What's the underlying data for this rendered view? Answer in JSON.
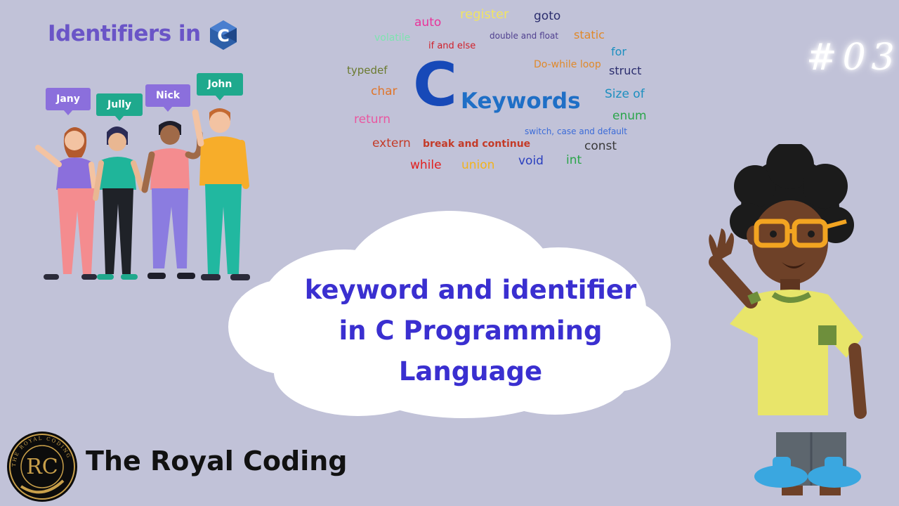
{
  "identifiers_heading": "Identifiers in",
  "c_logo_letter": "C",
  "people": [
    {
      "name": "Jany",
      "color": "#8b6fdc"
    },
    {
      "name": "Jully",
      "color": "#1fa98d"
    },
    {
      "name": "Nick",
      "color": "#8b6fdc"
    },
    {
      "name": "John",
      "color": "#1fa98d"
    }
  ],
  "keyword_cloud": {
    "big_letter": "C",
    "title": "Keywords",
    "words": {
      "register": "register",
      "goto": "goto",
      "auto": "auto",
      "volatile": "volatile",
      "double_float": "double and float",
      "static": "static",
      "if_else": "if and else",
      "for": "for",
      "typedef": "typedef",
      "do_while": "Do-while loop",
      "struct": "struct",
      "char": "char",
      "size_of": "Size of",
      "return": "return",
      "enum": "enum",
      "switch": "switch, case and default",
      "extern": "extern",
      "break_continue": "break and continue",
      "const": "const",
      "while": "while",
      "union": "union",
      "void": "void",
      "int": "int"
    }
  },
  "episode_tag": "#03",
  "headline": {
    "line1": "keyword and identifier",
    "line2": "in C Programming",
    "line3": "Language"
  },
  "brand": {
    "name": "The Royal Coding",
    "logo_initials": "RC",
    "logo_ring_text": "THE ROYAL CODING"
  },
  "colors": {
    "background": "#c1c2d8",
    "headline": "#3a2fd0",
    "identifiers": "#6a55c7",
    "keywords_title": "#1f6fc6"
  }
}
